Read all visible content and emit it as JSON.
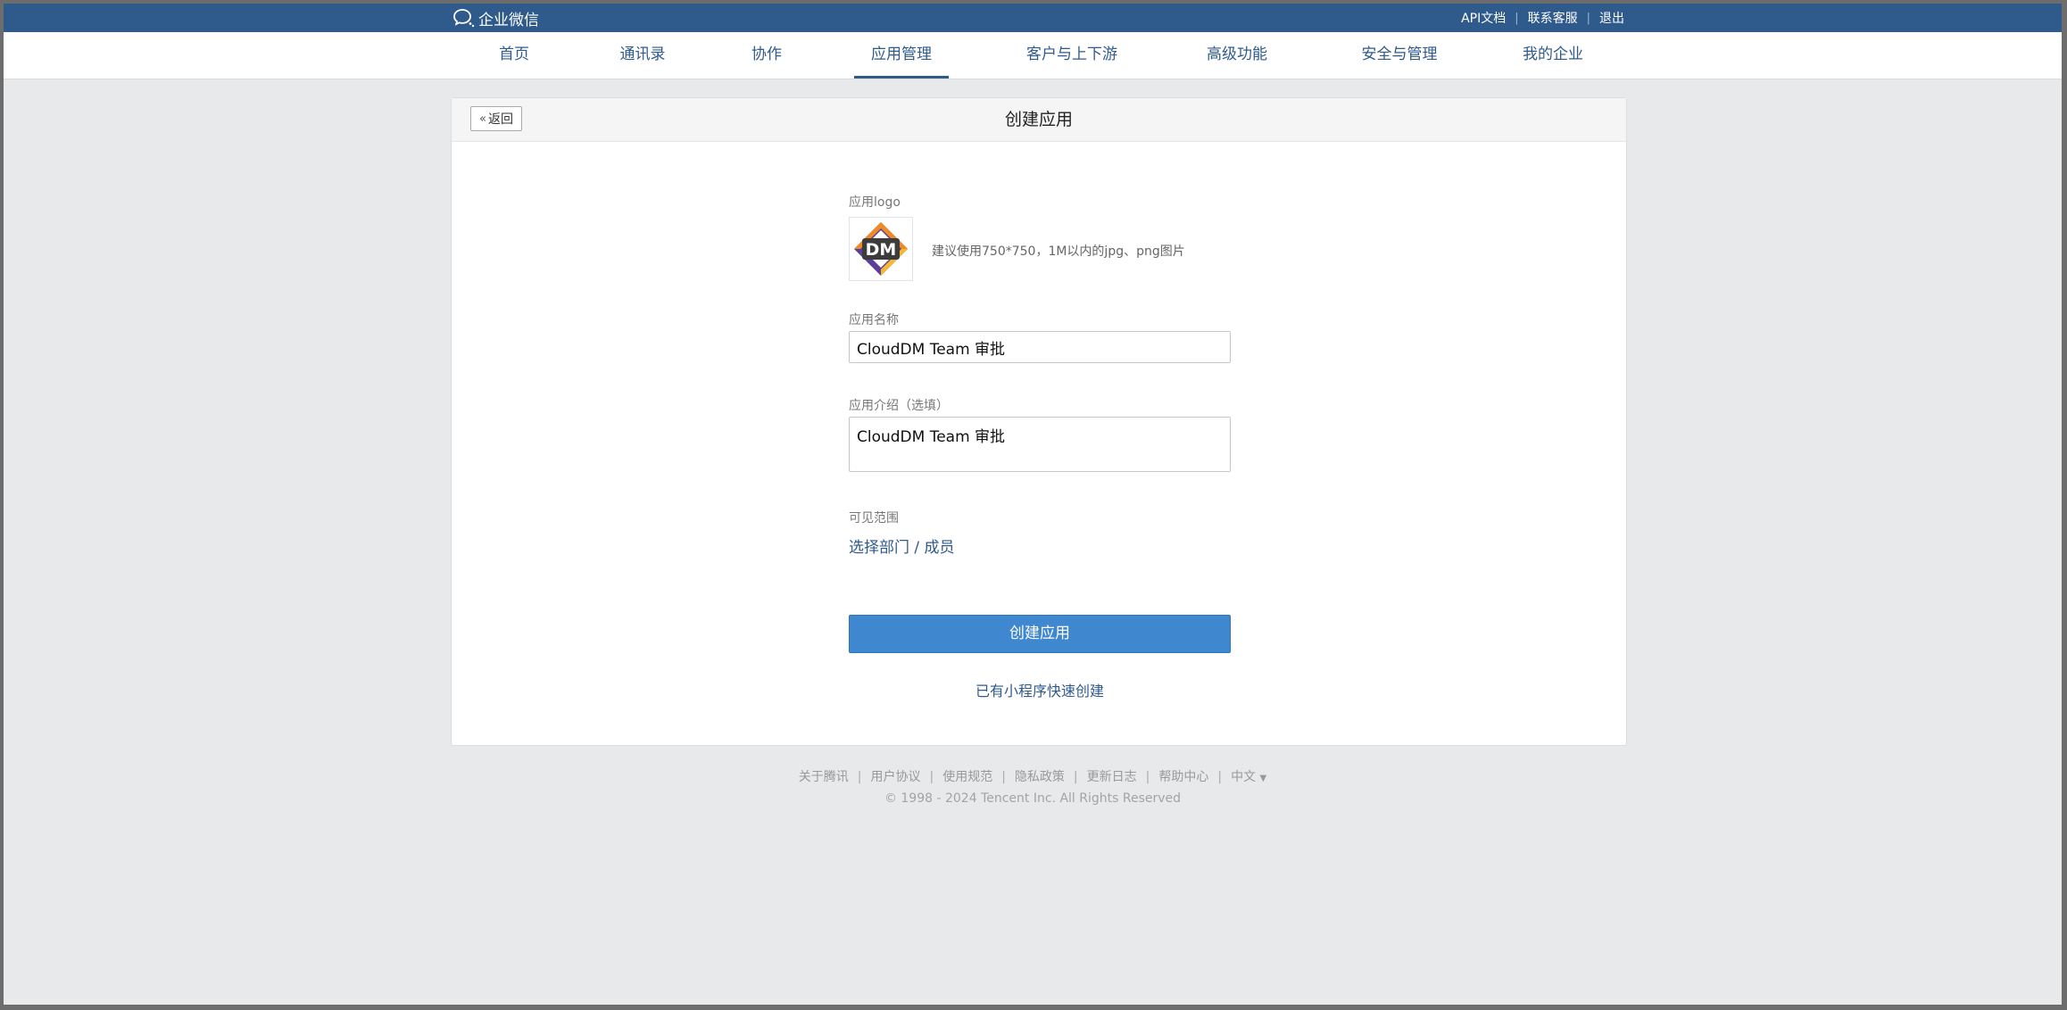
{
  "brand": {
    "name": "企业微信"
  },
  "top_links": [
    "API文档",
    "联系客服",
    "退出"
  ],
  "nav": {
    "items": [
      "首页",
      "通讯录",
      "协作",
      "应用管理",
      "客户与上下游",
      "高级功能",
      "安全与管理",
      "我的企业"
    ],
    "active": "应用管理"
  },
  "header": {
    "back_label": "返回",
    "title": "创建应用"
  },
  "form": {
    "logo_label": "应用logo",
    "logo_text": "DM",
    "logo_hint": "建议使用750*750，1M以内的jpg、png图片",
    "name_label": "应用名称",
    "name_value": "CloudDM Team 审批",
    "desc_label": "应用介绍（选填）",
    "desc_value": "CloudDM Team 审批",
    "visibility_label": "可见范围",
    "visibility_link": "选择部门 / 成员",
    "submit_label": "创建应用",
    "miniprogram_link": "已有小程序快速创建"
  },
  "footer": {
    "links": [
      "关于腾讯",
      "用户协议",
      "使用规范",
      "隐私政策",
      "更新日志",
      "帮助中心"
    ],
    "language": "中文",
    "language_caret": "▼",
    "copyright": "© 1998 - 2024 Tencent Inc. All Rights Reserved"
  },
  "colors": {
    "brand_blue": "#2f5a8c",
    "primary_button": "#3f87cf",
    "page_background": "#e8e9eb"
  }
}
